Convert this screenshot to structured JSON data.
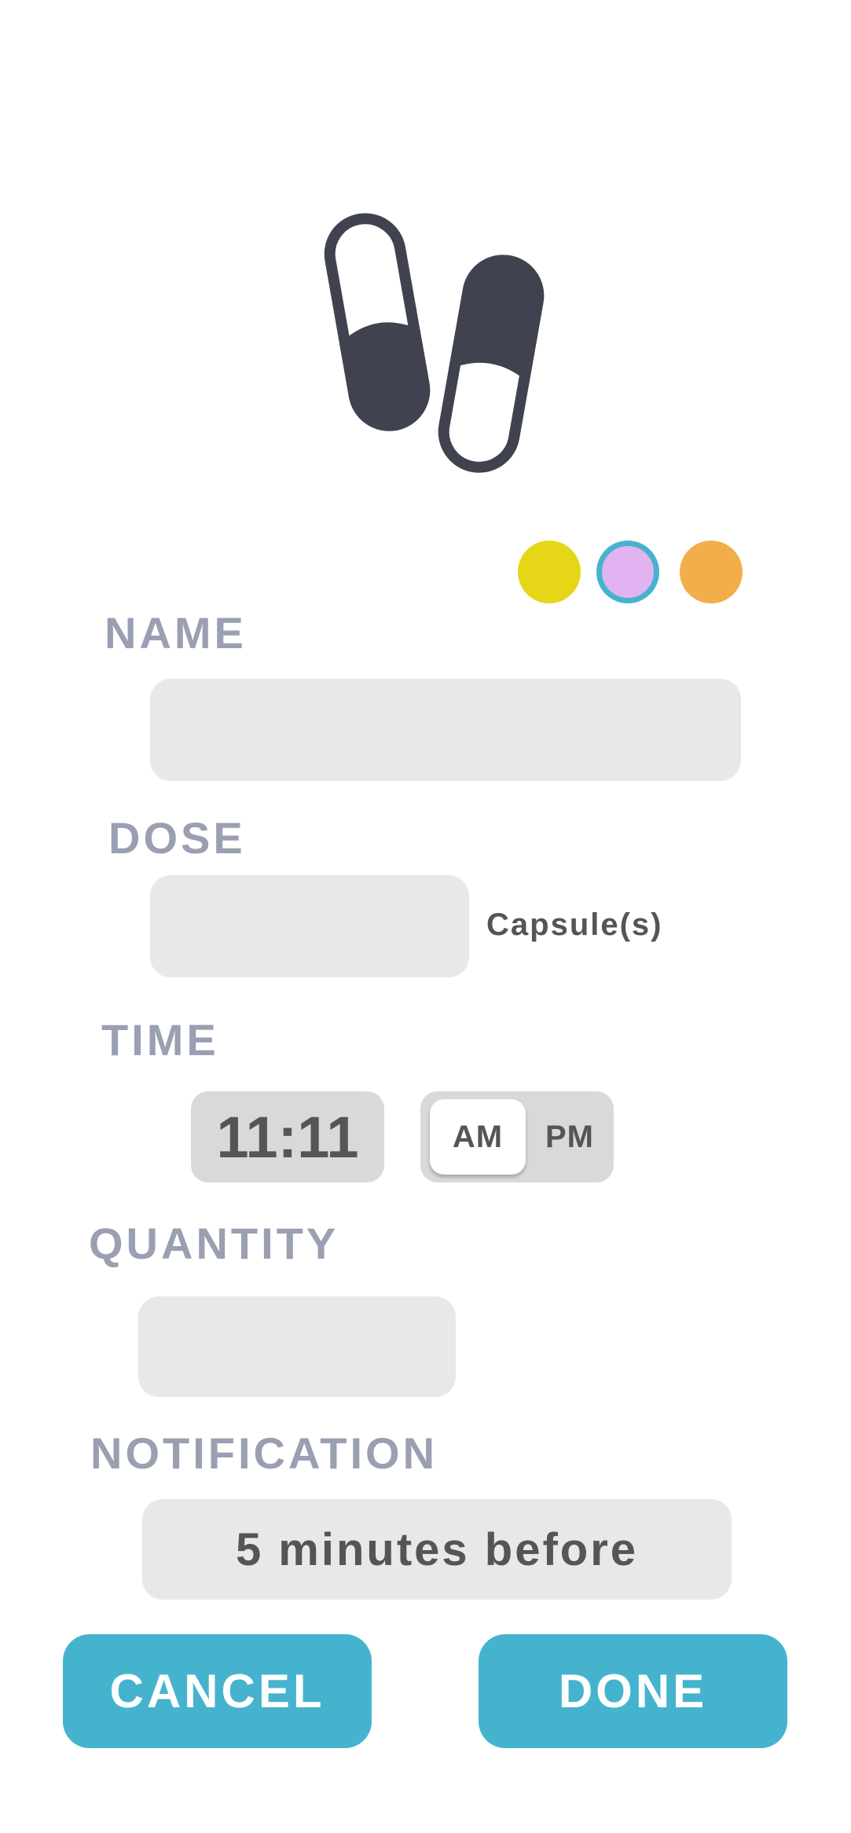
{
  "header": {
    "icon": "pill-capsules-icon"
  },
  "color_picker": {
    "options": [
      {
        "name": "yellow",
        "color": "#E5D617"
      },
      {
        "name": "pink",
        "color": "#E1B3F0",
        "selected": true,
        "ring_color": "#45B3CE"
      },
      {
        "name": "orange",
        "color": "#F2AE4B"
      }
    ]
  },
  "form": {
    "name": {
      "label": "NAME",
      "value": ""
    },
    "dose": {
      "label": "DOSE",
      "value": "",
      "unit": "Capsule(s)"
    },
    "time": {
      "label": "TIME",
      "value": "11:11",
      "am_label": "AM",
      "pm_label": "PM",
      "selected_period": "AM"
    },
    "quantity": {
      "label": "QUANTITY",
      "value": ""
    },
    "notification": {
      "label": "NOTIFICATION",
      "value": "5 minutes before"
    }
  },
  "actions": {
    "cancel_label": "CANCEL",
    "done_label": "DONE"
  },
  "colors": {
    "accent": "#45B3CE",
    "label": "#9A9FB2",
    "field_bg": "#E8E8E8",
    "icon": "#41424F"
  }
}
